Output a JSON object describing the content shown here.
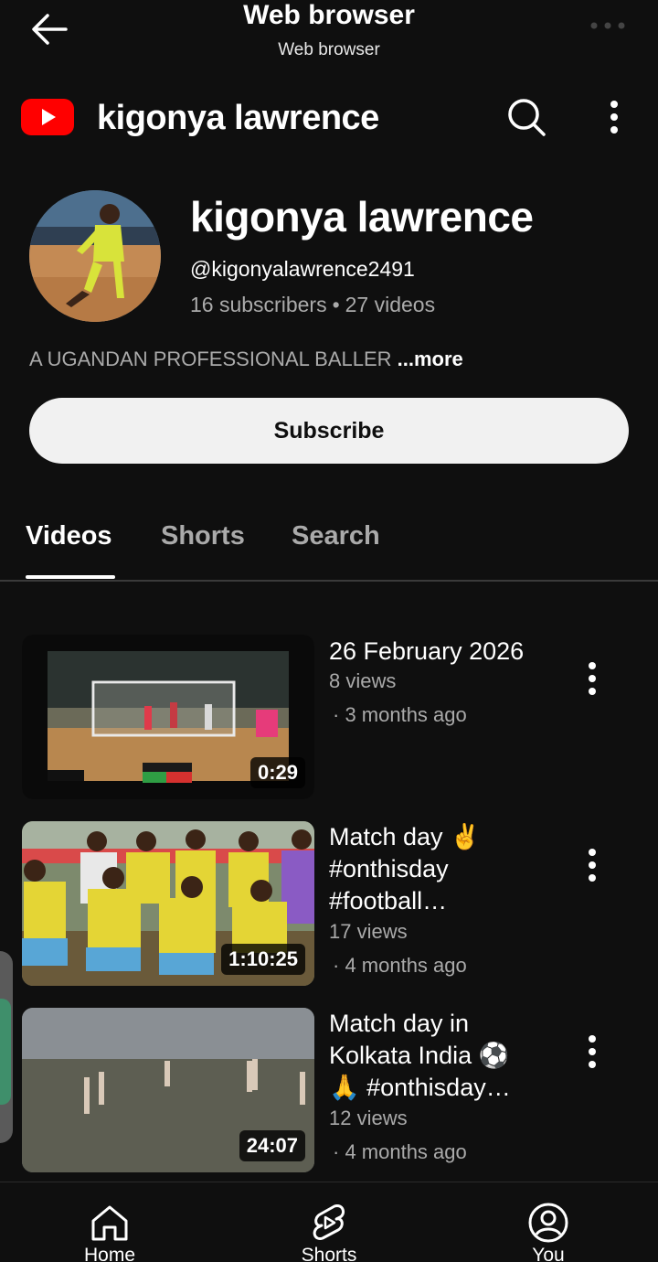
{
  "browser_bar": {
    "title": "Web browser",
    "subtitle": "Web browser",
    "back_icon": "arrow-left-icon",
    "menu_icon": "more-horizontal-icon"
  },
  "header": {
    "logo_icon": "youtube-logo",
    "title": "kigonya lawrence",
    "search_icon": "search-icon",
    "menu_icon": "more-vertical-icon"
  },
  "channel": {
    "name": "kigonya lawrence",
    "handle": "@kigonyalawrence2491",
    "subscribers": "16 subscribers",
    "separator": "•",
    "videos": "27 videos",
    "description": "A UGANDAN PROFESSIONAL BALLER ",
    "more_label": "...more",
    "subscribe_label": "Subscribe"
  },
  "tabs": [
    {
      "label": "Videos",
      "active": true
    },
    {
      "label": "Shorts",
      "active": false
    },
    {
      "label": "Search",
      "active": false
    }
  ],
  "videos": [
    {
      "title": "26 February 2026",
      "views": "8 views",
      "age": "· 3 months ago",
      "duration": "0:29"
    },
    {
      "title": "Match day ✌️ #onthisday #football…",
      "views": "17 views",
      "age": "· 4 months ago",
      "duration": "1:10:25"
    },
    {
      "title": "Match day in Kolkata India ⚽ 🙏 #onthisday…",
      "views": "12 views",
      "age": "· 4 months ago",
      "duration": "24:07"
    }
  ],
  "bottom_nav": [
    {
      "label": "Home",
      "icon": "home-icon"
    },
    {
      "label": "Shorts",
      "icon": "shorts-icon"
    },
    {
      "label": "You",
      "icon": "account-icon"
    }
  ],
  "colors": {
    "background": "#0f0f0f",
    "youtube_red": "#ff0000",
    "secondary_text": "#aaaaaa",
    "subscribe_bg": "#f1f1f1"
  }
}
